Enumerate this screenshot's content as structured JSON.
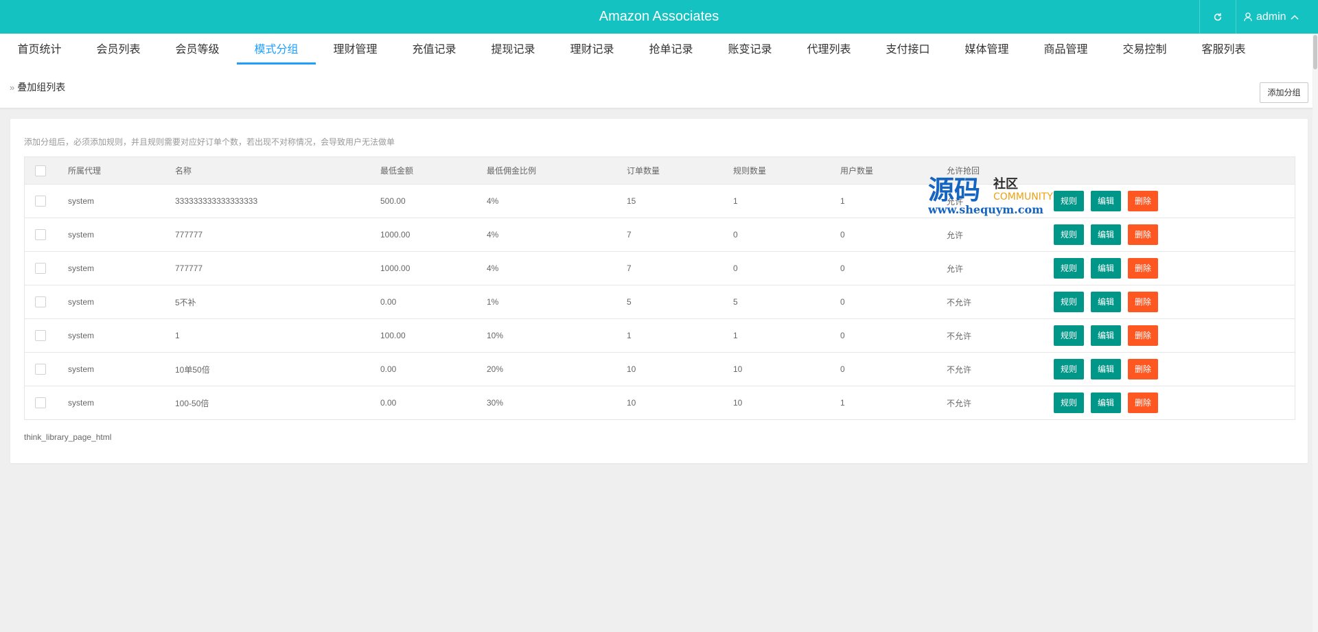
{
  "header": {
    "title": "Amazon Associates",
    "user": "admin",
    "bg_color": "#15c2c2"
  },
  "nav": {
    "tabs": [
      {
        "label": "首页统计"
      },
      {
        "label": "会员列表"
      },
      {
        "label": "会员等级"
      },
      {
        "label": "模式分组",
        "active": true
      },
      {
        "label": "理财管理"
      },
      {
        "label": "充值记录"
      },
      {
        "label": "提现记录"
      },
      {
        "label": "理财记录"
      },
      {
        "label": "抢单记录"
      },
      {
        "label": "账变记录"
      },
      {
        "label": "代理列表"
      },
      {
        "label": "支付接口"
      },
      {
        "label": "媒体管理"
      },
      {
        "label": "商品管理"
      },
      {
        "label": "交易控制"
      },
      {
        "label": "客服列表"
      }
    ],
    "active_color": "#1e9fff"
  },
  "breadcrumb": {
    "label": "叠加组列表",
    "add_button": "添加分组"
  },
  "tip": "添加分组后，必须添加规则，并且规则需要对应好订单个数，若出现不对称情况，会导致用户无法做单",
  "table": {
    "headers": [
      "所属代理",
      "名称",
      "最低金额",
      "最低佣金比例",
      "订单数量",
      "规则数量",
      "用户数量",
      "允许抢回"
    ],
    "rows": [
      {
        "agent": "system",
        "name": "333333333333333333",
        "min_amount": "500.00",
        "min_rate": "4%",
        "orders": "15",
        "rules": "1",
        "users": "1",
        "allow": "允许"
      },
      {
        "agent": "system",
        "name": "777777",
        "min_amount": "1000.00",
        "min_rate": "4%",
        "orders": "7",
        "rules": "0",
        "users": "0",
        "allow": "允许"
      },
      {
        "agent": "system",
        "name": "777777",
        "min_amount": "1000.00",
        "min_rate": "4%",
        "orders": "7",
        "rules": "0",
        "users": "0",
        "allow": "允许"
      },
      {
        "agent": "system",
        "name": "5不补",
        "min_amount": "0.00",
        "min_rate": "1%",
        "orders": "5",
        "rules": "5",
        "users": "0",
        "allow": "不允许"
      },
      {
        "agent": "system",
        "name": "1",
        "min_amount": "100.00",
        "min_rate": "10%",
        "orders": "1",
        "rules": "1",
        "users": "0",
        "allow": "不允许"
      },
      {
        "agent": "system",
        "name": "10单50倍",
        "min_amount": "0.00",
        "min_rate": "20%",
        "orders": "10",
        "rules": "10",
        "users": "0",
        "allow": "不允许"
      },
      {
        "agent": "system",
        "name": "100-50倍",
        "min_amount": "0.00",
        "min_rate": "30%",
        "orders": "10",
        "rules": "10",
        "users": "1",
        "allow": "不允许"
      }
    ],
    "actions": {
      "rule": "规则",
      "edit": "编辑",
      "delete": "删除"
    },
    "action_colors": {
      "primary": "#009688",
      "danger": "#ff5722"
    }
  },
  "pager": "think_library_page_html",
  "watermark": {
    "main": "源码",
    "sub": "社区",
    "community": "COMMUNITY",
    "url": "www.shequym.com"
  }
}
